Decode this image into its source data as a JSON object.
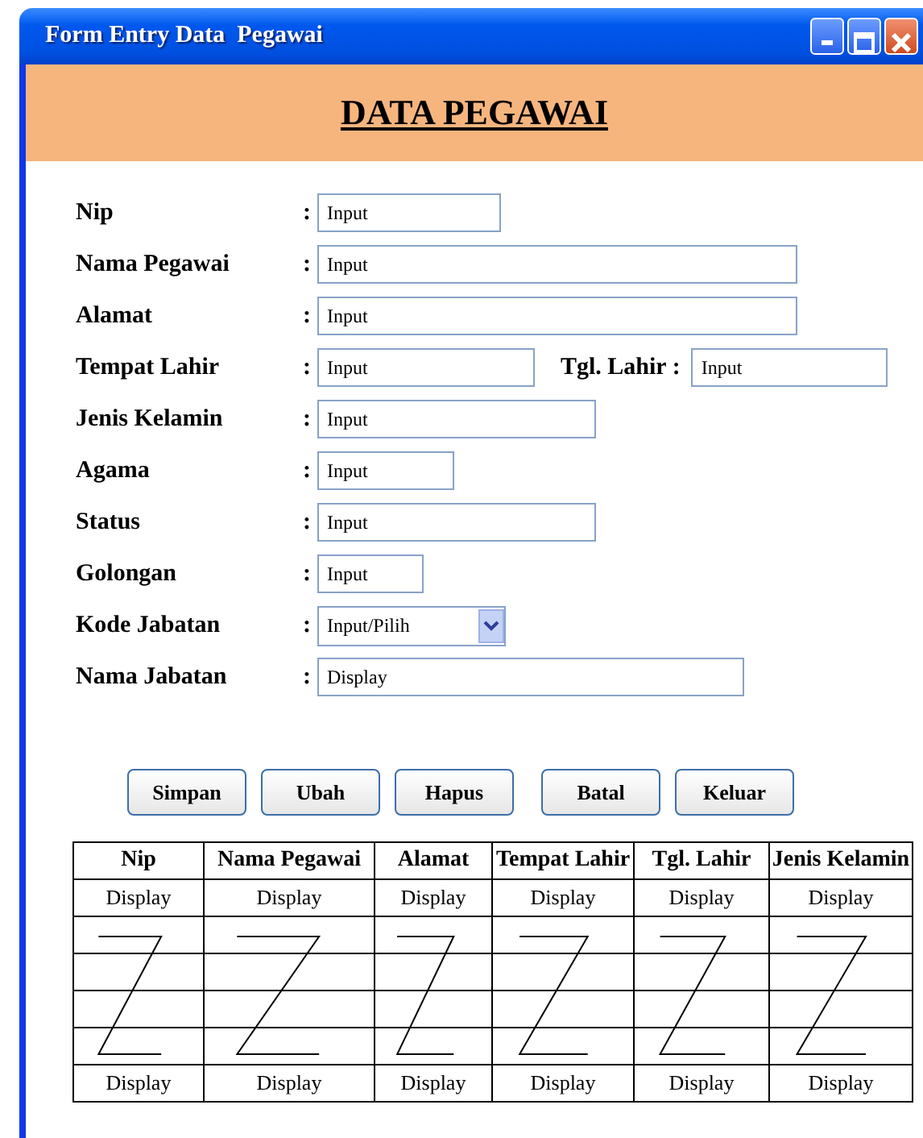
{
  "window": {
    "title": "Form Entry Data  Pegawai"
  },
  "header": {
    "title": "DATA PEGAWAI"
  },
  "fields": [
    {
      "label": "Nip",
      "colon": ":",
      "value": "Input",
      "kind": "text"
    },
    {
      "label": "Nama Pegawai",
      "colon": ":",
      "value": "Input",
      "kind": "text"
    },
    {
      "label": "Alamat",
      "colon": ":",
      "value": "Input",
      "kind": "text"
    },
    {
      "label": "Tempat Lahir",
      "colon": ":",
      "value": "Input",
      "kind": "text",
      "extra": {
        "label": "Tgl. Lahir :",
        "value": "Input"
      }
    },
    {
      "label": "Jenis Kelamin",
      "colon": ":",
      "value": "Input",
      "kind": "text"
    },
    {
      "label": "Agama",
      "colon": ":",
      "value": "Input",
      "kind": "text"
    },
    {
      "label": "Status",
      "colon": ":",
      "value": "Input",
      "kind": "text"
    },
    {
      "label": "Golongan",
      "colon": ":",
      "value": "Input",
      "kind": "text"
    },
    {
      "label": "Kode Jabatan",
      "colon": ":",
      "value": "Input/Pilih",
      "kind": "select"
    },
    {
      "label": "Nama Jabatan",
      "colon": ":",
      "value": "Display",
      "kind": "text"
    }
  ],
  "buttons": [
    "Simpan",
    "Ubah",
    "Hapus",
    "Batal",
    "Keluar"
  ],
  "table": {
    "columns": [
      "Nip",
      "Nama Pegawai",
      "Alamat",
      "Tempat Lahir",
      "Tgl. Lahir",
      "Jenis Kelamin"
    ],
    "rows": [
      [
        "Display",
        "Display",
        "Display",
        "Display",
        "Display",
        "Display"
      ],
      [
        "Display",
        "Display",
        "Display",
        "Display",
        "Display",
        "Display"
      ]
    ]
  }
}
